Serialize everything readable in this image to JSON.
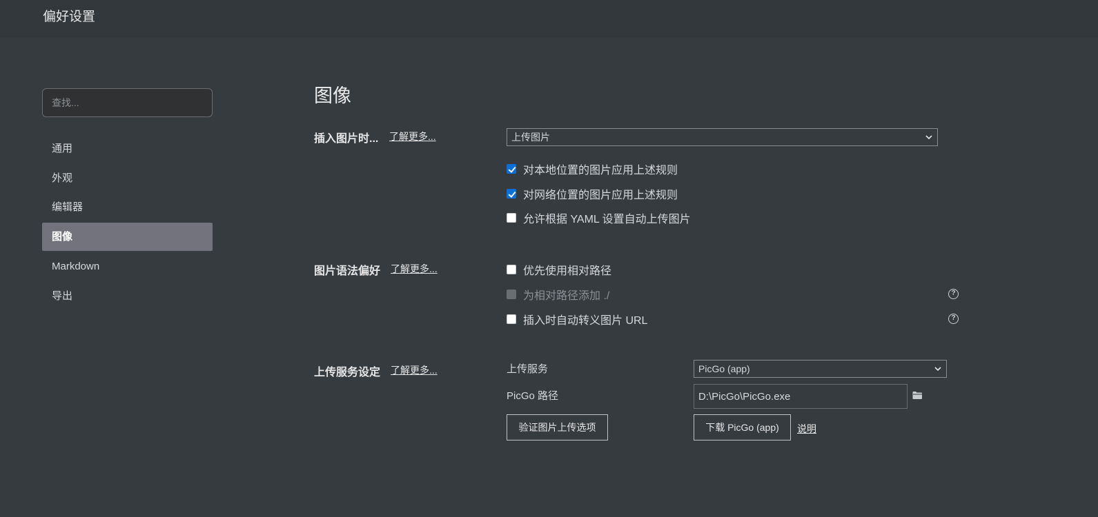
{
  "window": {
    "title": "偏好设置"
  },
  "search": {
    "placeholder": "查找..."
  },
  "sidebar": {
    "items": [
      {
        "label": "通用"
      },
      {
        "label": "外观"
      },
      {
        "label": "编辑器"
      },
      {
        "label": "图像",
        "active": true
      },
      {
        "label": "Markdown"
      },
      {
        "label": "导出"
      }
    ]
  },
  "main": {
    "title": "图像",
    "insert_section": {
      "label": "插入图片时...",
      "learn_more": "了解更多...",
      "select_value": "上传图片",
      "options": [
        {
          "label": "对本地位置的图片应用上述规则",
          "checked": true
        },
        {
          "label": "对网络位置的图片应用上述规则",
          "checked": true
        },
        {
          "label": "允许根据 YAML 设置自动上传图片",
          "checked": false
        }
      ]
    },
    "syntax_section": {
      "label": "图片语法偏好",
      "learn_more": "了解更多...",
      "options": [
        {
          "label": "优先使用相对路径",
          "checked": false
        },
        {
          "label": "为相对路径添加 ./",
          "checked": false,
          "disabled": true,
          "help_icon": "question-circle-icon"
        },
        {
          "label": "插入时自动转义图片 URL",
          "checked": false,
          "help_icon": "question-circle-icon"
        }
      ]
    },
    "upload_section": {
      "label": "上传服务设定",
      "learn_more": "了解更多...",
      "service_label": "上传服务",
      "service_value": "PicGo (app)",
      "path_label": "PicGo 路径",
      "path_value": "D:\\PicGo\\PicGo.exe",
      "validate_button": "验证图片上传选项",
      "download_button": "下载 PicGo (app)",
      "help_link": "说明"
    }
  },
  "colors": {
    "background": "#363b40",
    "titlebar": "#33383d",
    "active_nav": "#72737c",
    "checkbox_checked": "#0b6fd8"
  }
}
